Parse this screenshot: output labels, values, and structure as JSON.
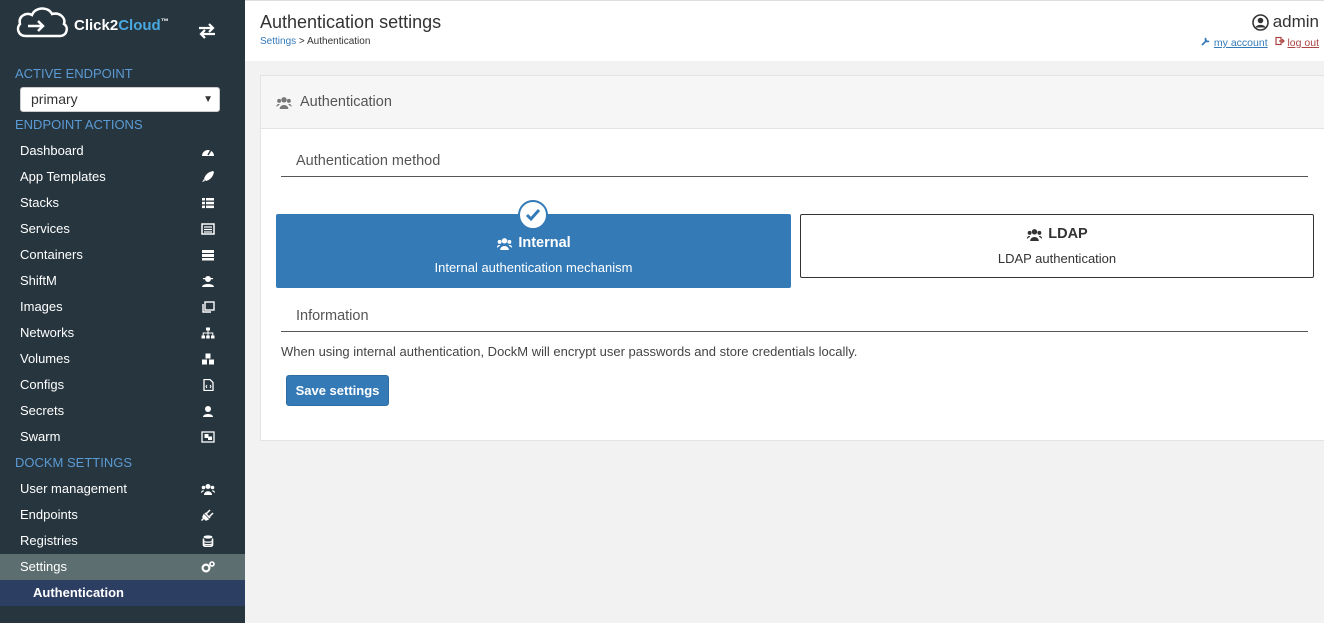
{
  "brand": {
    "name_part1": "Click2",
    "name_part2": "Cloud",
    "tm": "™"
  },
  "sidebar": {
    "active_endpoint_label": "ACTIVE ENDPOINT",
    "endpoint_value": "primary",
    "endpoint_actions_label": "ENDPOINT ACTIONS",
    "items": [
      {
        "label": "Dashboard",
        "icon": "dashboard-icon"
      },
      {
        "label": "App Templates",
        "icon": "rocket-icon"
      },
      {
        "label": "Stacks",
        "icon": "th-list-icon"
      },
      {
        "label": "Services",
        "icon": "list-alt-icon"
      },
      {
        "label": "Containers",
        "icon": "server-icon"
      },
      {
        "label": "ShiftM",
        "icon": "user-secret-icon"
      },
      {
        "label": "Images",
        "icon": "clone-icon"
      },
      {
        "label": "Networks",
        "icon": "sitemap-icon"
      },
      {
        "label": "Volumes",
        "icon": "cubes-icon"
      },
      {
        "label": "Configs",
        "icon": "file-code-icon"
      },
      {
        "label": "Secrets",
        "icon": "user-secret-icon"
      },
      {
        "label": "Swarm",
        "icon": "object-group-icon"
      }
    ],
    "settings_label": "DOCKM SETTINGS",
    "settings_items": [
      {
        "label": "User management",
        "icon": "users-icon"
      },
      {
        "label": "Endpoints",
        "icon": "plug-icon"
      },
      {
        "label": "Registries",
        "icon": "database-icon"
      },
      {
        "label": "Settings",
        "icon": "cogs-icon"
      }
    ],
    "sub_item": "Authentication"
  },
  "header": {
    "title": "Authentication settings",
    "breadcrumb_link": "Settings",
    "breadcrumb_sep": " > ",
    "breadcrumb_current": "Authentication",
    "username": "admin",
    "my_account": "my account",
    "log_out": "log out"
  },
  "panel": {
    "title": "Authentication",
    "method_legend": "Authentication method",
    "internal_title": "Internal",
    "internal_desc": "Internal authentication mechanism",
    "ldap_title": "LDAP",
    "ldap_desc": "LDAP authentication",
    "info_legend": "Information",
    "info_text": "When using internal authentication, DockM will encrypt user passwords and store credentials locally.",
    "save_label": "Save settings"
  },
  "colors": {
    "accent": "#337ab7",
    "sidebar_bg": "#27353e",
    "section_label": "#5b9bd5"
  }
}
